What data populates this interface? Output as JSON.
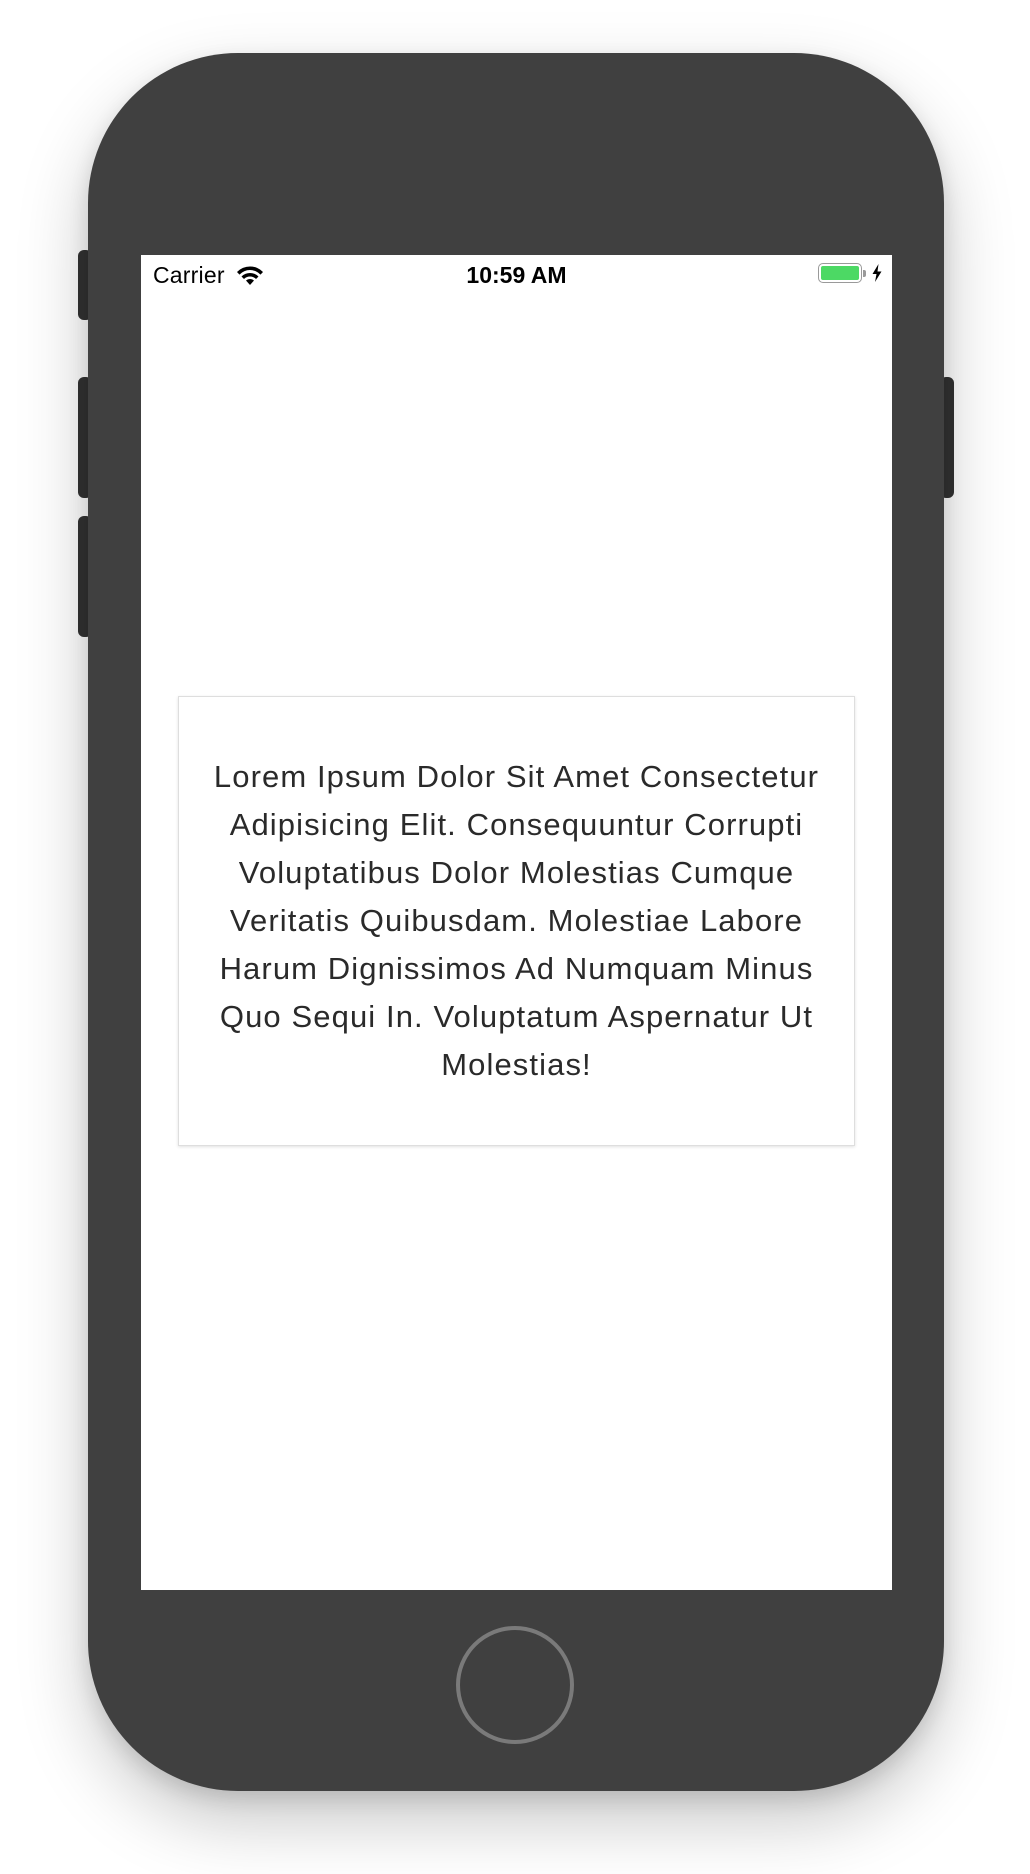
{
  "status_bar": {
    "carrier": "Carrier",
    "time": "10:59 AM",
    "wifi_icon": "wifi-icon",
    "battery_icon": "battery-icon",
    "charging_icon": "charging-bolt-icon",
    "battery_color": "#4cd964"
  },
  "card": {
    "text": "Lorem Ipsum Dolor Sit Amet Consectetur Adipisicing Elit. Consequuntur Corrupti Voluptatibus Dolor Molestias Cumque Veritatis Quibusdam. Molestiae Labore Harum Dignissimos Ad Numquam Minus Quo Sequi In. Voluptatum Aspernatur Ut Molestias!"
  },
  "device": {
    "frame_color": "#404040",
    "home_button_icon": "home-button"
  }
}
